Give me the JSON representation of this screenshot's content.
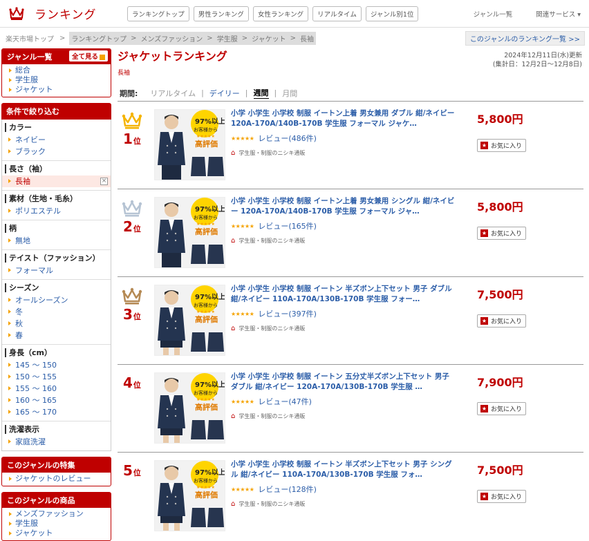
{
  "header": {
    "logo_text": "ランキング",
    "nav": [
      "ランキングトップ",
      "男性ランキング",
      "女性ランキング",
      "リアルタイム",
      "ジャンル別1位"
    ],
    "right_links": [
      "ジャンル一覧",
      "関連サービス ▾"
    ]
  },
  "breadcrumb": {
    "home": "楽天市場トップ",
    "sep": ">",
    "path": [
      "ランキングトップ",
      "メンズファッション",
      "学生服",
      "ジャケット",
      "長袖"
    ],
    "genre_all_link": "このジャンルのランキング一覧 >>"
  },
  "sidebar": {
    "genre_box": {
      "title": "ジャンル一覧",
      "see_all": "全て見る",
      "items": [
        "総合",
        "学生服",
        "ジャケット"
      ]
    },
    "filter_title": "条件で絞り込む",
    "filters": [
      {
        "head": "カラー",
        "items": [
          "ネイビー",
          "ブラック"
        ]
      },
      {
        "head": "長さ（袖）",
        "items": [
          "長袖"
        ],
        "selected": true
      },
      {
        "head": "素材（生地・毛糸）",
        "items": [
          "ポリエステル"
        ]
      },
      {
        "head": "柄",
        "items": [
          "無地"
        ]
      },
      {
        "head": "テイスト（ファッション）",
        "items": [
          "フォーマル"
        ]
      },
      {
        "head": "シーズン",
        "items": [
          "オールシーズン",
          "冬",
          "秋",
          "春"
        ]
      },
      {
        "head": "身長（cm）",
        "items": [
          "145 ～ 150",
          "150 ～ 155",
          "155 ～ 160",
          "160 ～ 165",
          "165 ～ 170"
        ]
      },
      {
        "head": "洗濯表示",
        "items": [
          "家庭洗濯"
        ]
      }
    ],
    "feature_box": {
      "title": "このジャンルの特集",
      "items": [
        "ジャケットのレビュー"
      ]
    },
    "products_box": {
      "title": "このジャンルの商品",
      "items": [
        "メンズファッション",
        "学生服",
        "ジャケット"
      ]
    }
  },
  "main": {
    "title": "ジャケットランキング",
    "subgenre": "長袖",
    "updated": "2024年12月11日(水)更新",
    "period_range": "(集計日：12月2日～12月8日)",
    "period": {
      "label": "期間:",
      "realtime": "リアルタイム",
      "daily": "デイリー",
      "weekly": "週間",
      "monthly": "月間",
      "sep": "|"
    },
    "thumb_badge": {
      "line1": "97",
      "line2": "%以上の",
      "line3": "お客様から",
      "line4": "高評価",
      "stars": "★★★★★"
    },
    "fav_label": "お気に入り",
    "items": [
      {
        "rank": "1",
        "rank_suffix": "位",
        "title": "小学 小学生 小学校 制服 イートン上着 男女兼用 ダブル 紺/ネイビー 120A-170A/140B-170B 学生服 フォーマル ジャケ…",
        "stars": "★★★★★",
        "reviews": "レビュー(486件)",
        "shop": "学生服・制服のニシキ通販",
        "price": "5,800円",
        "crown_color": "#f5b400",
        "shorts": false
      },
      {
        "rank": "2",
        "rank_suffix": "位",
        "title": "小学 小学生 小学校 制服 イートン上着 男女兼用 シングル 紺/ネイビー 120A-170A/140B-170B 学生服 フォーマル ジャ…",
        "stars": "★★★★★",
        "reviews": "レビュー(165件)",
        "shop": "学生服・制服のニシキ通販",
        "price": "5,800円",
        "crown_color": "#b6c4d4",
        "shorts": false
      },
      {
        "rank": "3",
        "rank_suffix": "位",
        "title": "小学 小学生 小学校 制服 イートン 半ズボン上下セット 男子 ダブル 紺/ネイビー 110A-170A/130B-170B 学生服 フォー…",
        "stars": "★★★★★",
        "reviews": "レビュー(397件)",
        "shop": "学生服・制服のニシキ通販",
        "price": "7,500円",
        "crown_color": "#b58a55",
        "shorts": true
      },
      {
        "rank": "4",
        "rank_suffix": "位",
        "title": "小学 小学生 小学校 制服 イートン 五分丈半ズボン上下セット 男子 ダブル 紺/ネイビー 120A-170A/130B-170B 学生服 …",
        "stars": "★★★★★",
        "reviews": "レビュー(47件)",
        "shop": "学生服・制服のニシキ通販",
        "price": "7,900円",
        "crown_color": "",
        "shorts": true
      },
      {
        "rank": "5",
        "rank_suffix": "位",
        "title": "小学 小学生 小学校 制服 イートン 半ズボン上下セット 男子 シングル 紺/ネイビー 110A-170A/130B-170B 学生服 フォ…",
        "stars": "★★★★★",
        "reviews": "レビュー(128件)",
        "shop": "学生服・制服のニシキ通販",
        "price": "7,500円",
        "crown_color": "",
        "shorts": true
      }
    ]
  }
}
